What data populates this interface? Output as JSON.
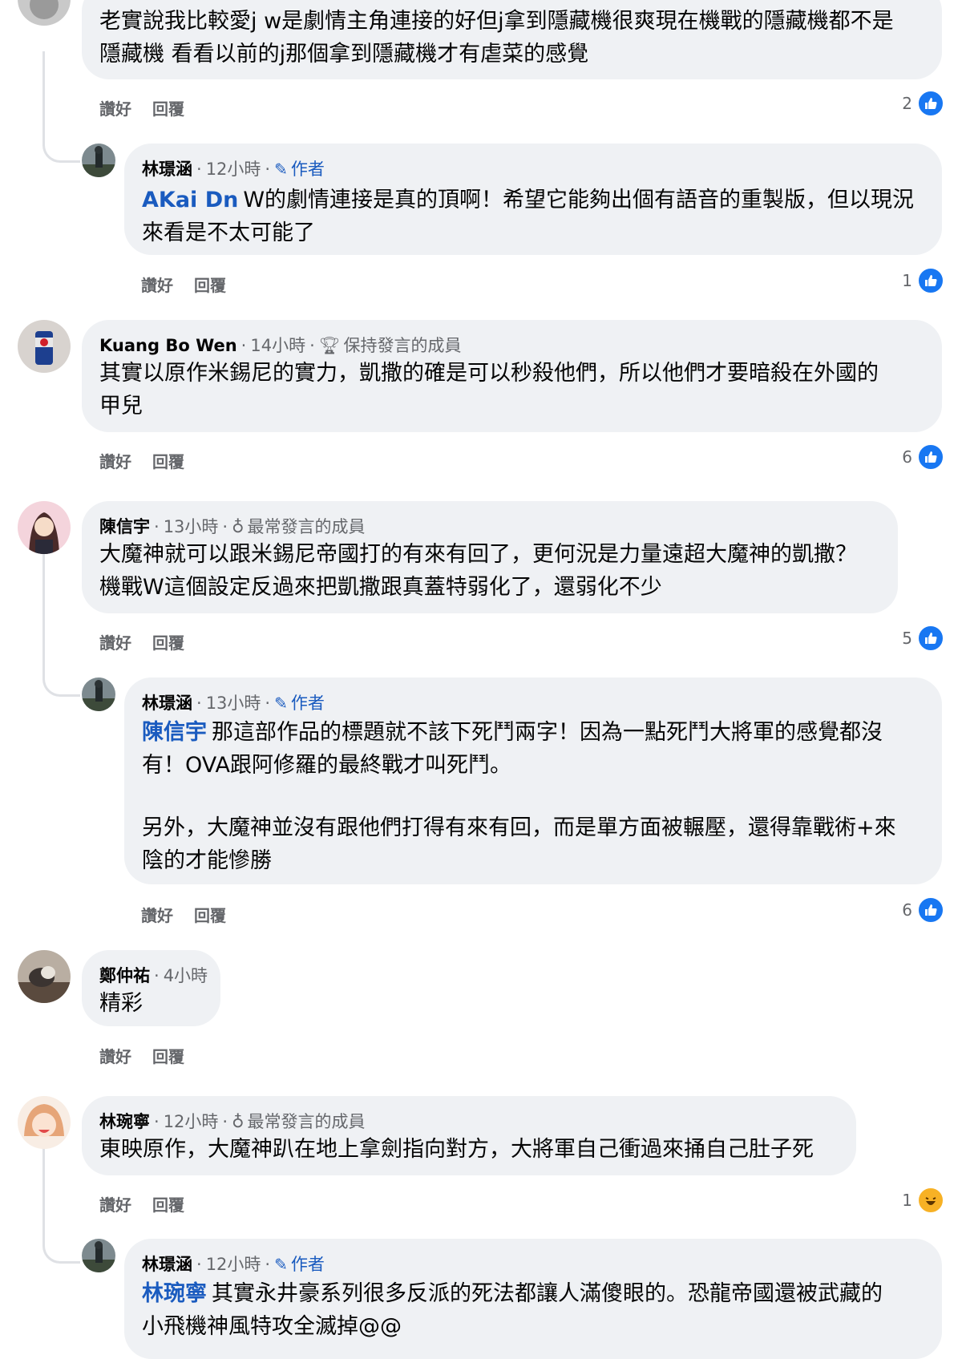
{
  "actions": {
    "like": "讚好",
    "reply": "回覆"
  },
  "meta_sep": "·",
  "author_label": "作者",
  "comments": [
    {
      "name": "",
      "lines": [
        "老實說我比較愛j w是劇情主角連接的好但j拿到隱藏機很爽現在機戰的隱藏機都不是",
        "隱藏機 看看以前的j那個拿到隱藏機才有虐菜的感覺"
      ],
      "reaction_count": "2",
      "reaction": "like-icon"
    },
    {
      "name": "林璟涵",
      "time": "12小時",
      "mention": "AKai Dn",
      "lines": [
        "W的劇情連接是真的頂啊！希望它能夠出個有語音的重製版，但以現況",
        "來看是不太可能了"
      ],
      "reaction_count": "1",
      "reaction": "like-icon"
    },
    {
      "name": "Kuang Bo Wen",
      "time": "14小時",
      "badge": "保持發言的成員",
      "lines": [
        "其實以原作米錫尼的實力，凱撒的確是可以秒殺他們，所以他們才要暗殺在外國的",
        "甲兒"
      ],
      "reaction_count": "6",
      "reaction": "like-icon"
    },
    {
      "name": "陳信宇",
      "time": "13小時",
      "badge": "最常發言的成員",
      "lines": [
        "大魔神就可以跟米錫尼帝國打的有來有回了，更何況是力量遠超大魔神的凱撒？",
        "機戰W這個設定反過來把凱撒跟真蓋特弱化了，還弱化不少"
      ],
      "reaction_count": "5",
      "reaction": "like-icon"
    },
    {
      "name": "林璟涵",
      "time": "13小時",
      "mention": "陳信宇",
      "lines": [
        "那這部作品的標題就不該下死鬥兩字！因為一點死鬥大將軍的感覺都沒",
        "有！OVA跟阿修羅的最終戰才叫死鬥。"
      ],
      "lines2": [
        "另外，大魔神並沒有跟他們打得有來有回，而是單方面被輾壓，還得靠戰術+來",
        "陰的才能慘勝"
      ],
      "reaction_count": "6",
      "reaction": "like-icon"
    },
    {
      "name": "鄭仲祐",
      "time": "4小時",
      "lines": [
        "精彩"
      ]
    },
    {
      "name": "林琬寧",
      "time": "12小時",
      "badge": "最常發言的成員",
      "lines": [
        "東映原作，大魔神趴在地上拿劍指向對方，大將軍自己衝過來捅自己肚子死"
      ],
      "reaction_count": "1",
      "reaction": "haha-icon"
    },
    {
      "name": "林璟涵",
      "time": "12小時",
      "mention": "林琬寧",
      "lines": [
        "其實永井豪系列很多反派的死法都讓人滿傻眼的。恐龍帝國還被武藏的",
        "小飛機神風特攻全滅掉@@"
      ]
    }
  ]
}
